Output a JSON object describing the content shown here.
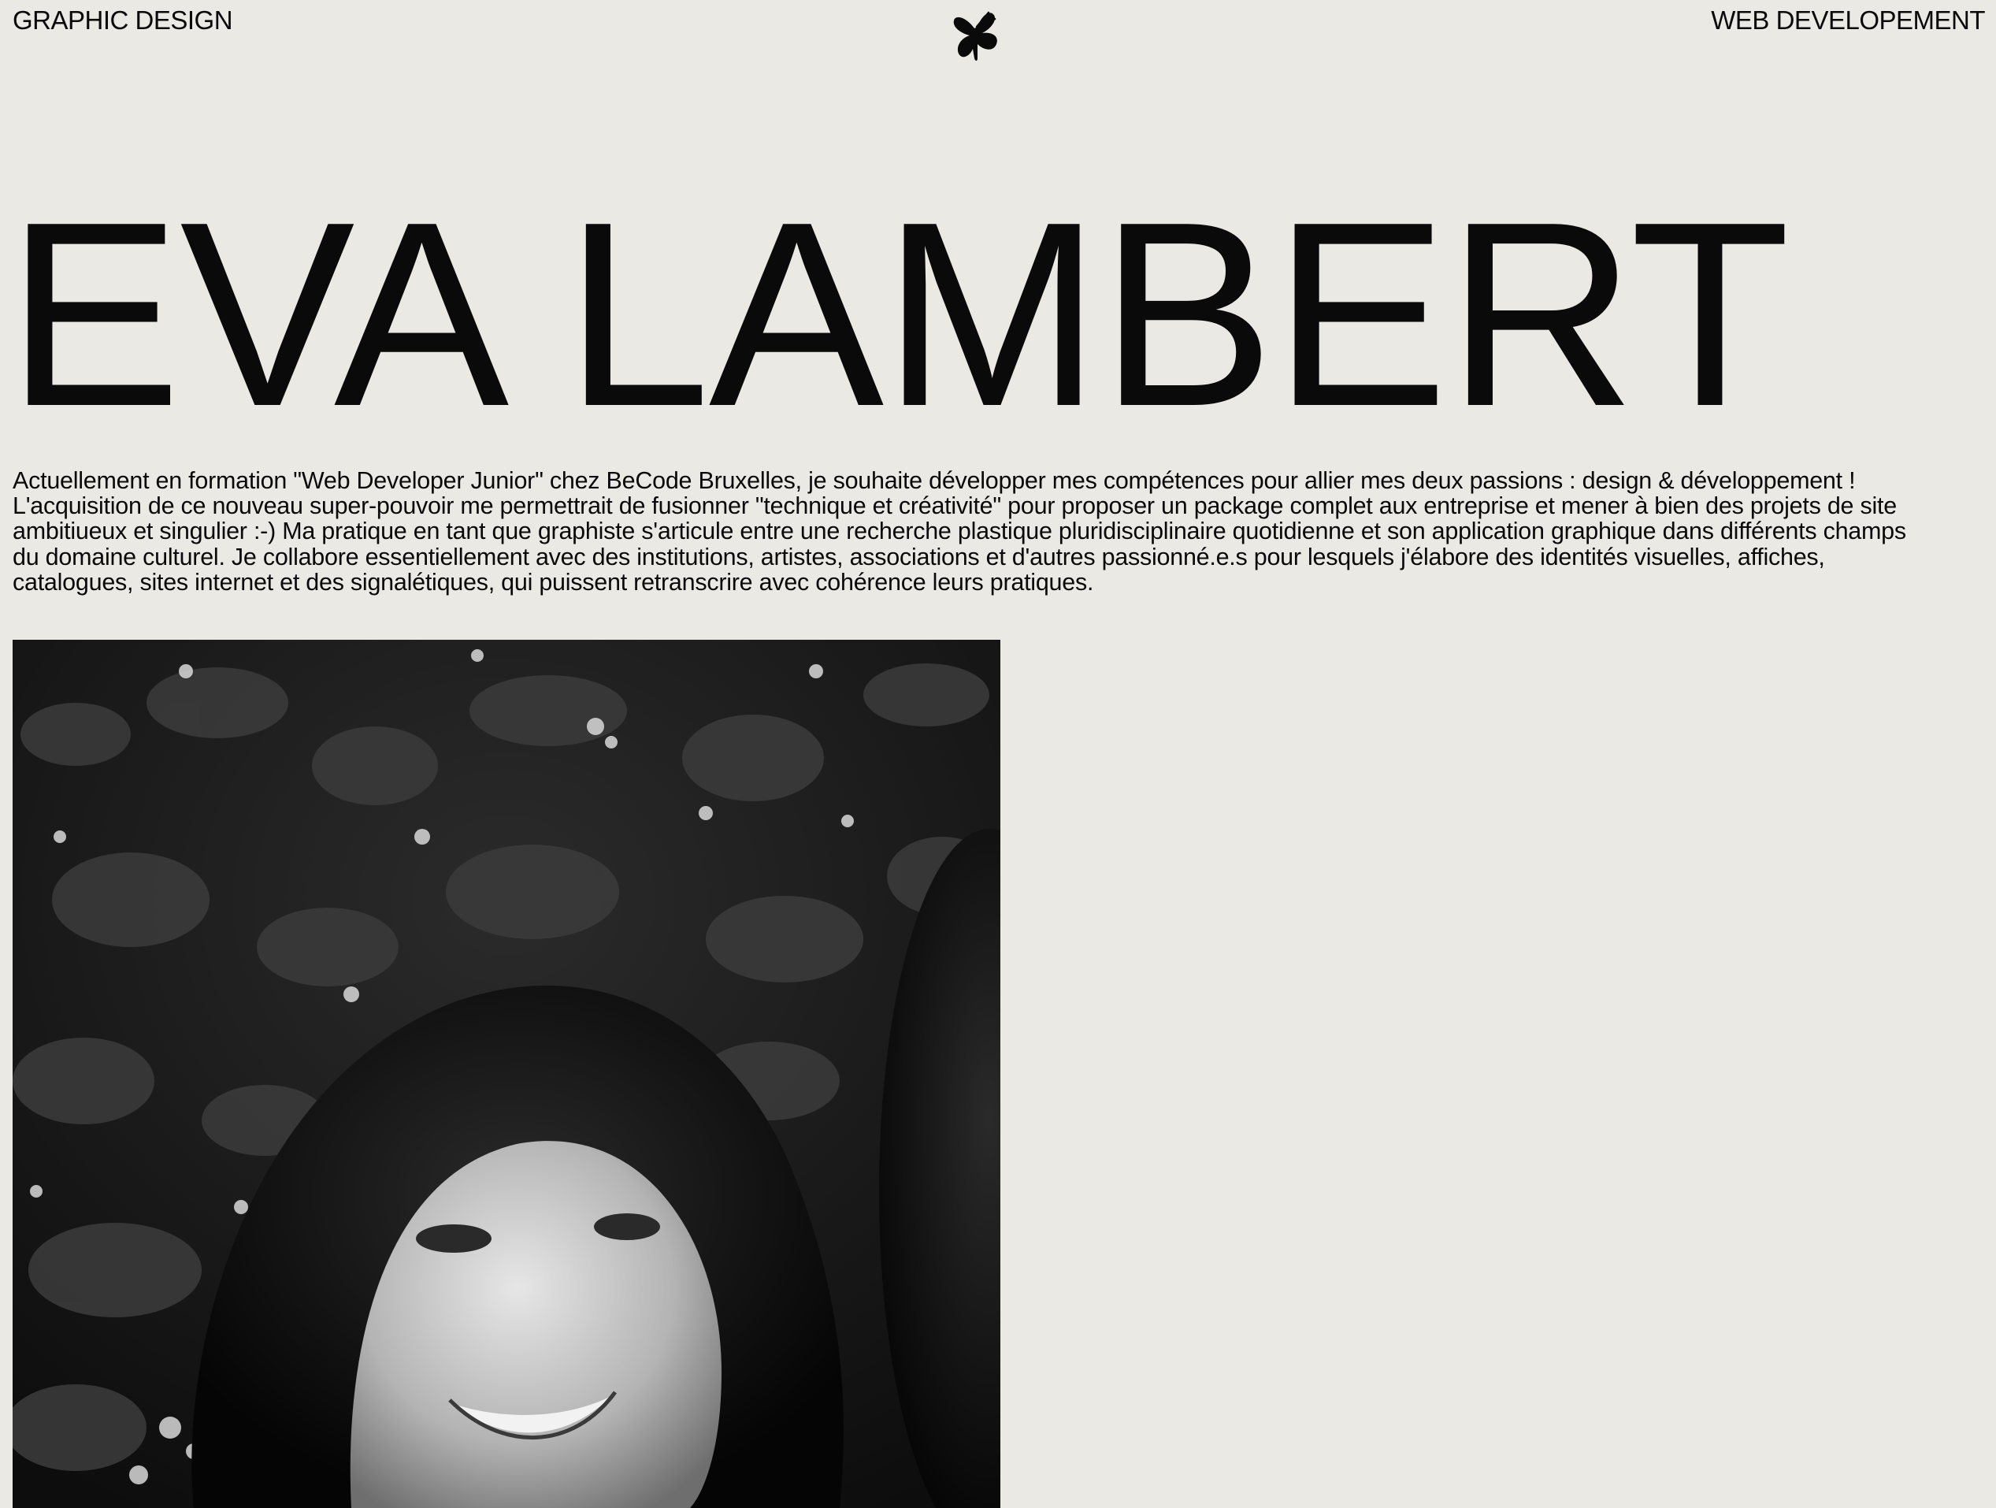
{
  "header": {
    "left_link": "GRAPHIC DESIGN",
    "right_link": "WEB DEVELOPEMENT",
    "logo_icon": "butterfly-icon"
  },
  "hero": {
    "name": "EVA LAMBERT"
  },
  "bio": {
    "text": "Actuellement en formation \"Web Developer Junior\" chez BeCode Bruxelles, je souhaite développer mes compétences pour allier mes deux passions : design & développement ! L'acquisition de ce nouveau super-pouvoir me permettrait de fusionner \"technique et créativité\" pour proposer un package complet aux entreprise et mener à bien des projets de site ambitiueux et singulier :-) Ma pratique en tant que graphiste s'articule entre une recherche plastique pluridisciplinaire quotidienne et son application graphique dans différents champs du domaine culturel. Je collabore essentiellement avec des institutions, artistes, associations et d'autres passionné.e.s pour lesquels j'élabore des identités visuelles, affiches, catalogues, sites internet et des signalétiques, qui puissent retranscrire avec cohérence leurs pratiques."
  },
  "colors": {
    "background": "#ebe9e4",
    "text": "#0a0a0a"
  }
}
